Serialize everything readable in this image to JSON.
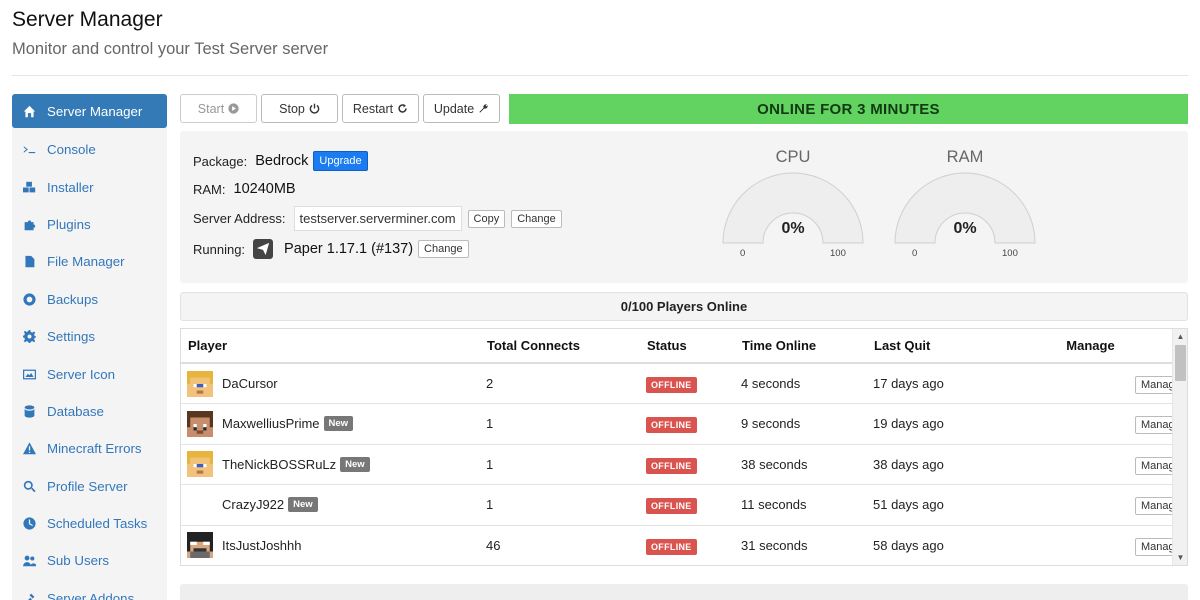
{
  "header": {
    "title": "Server Manager",
    "subtitle": "Monitor and control your Test Server server"
  },
  "sidebar": {
    "items": [
      {
        "label": "Server Manager",
        "icon": "home-icon",
        "active": true
      },
      {
        "label": "Console",
        "icon": "terminal-icon"
      },
      {
        "label": "Installer",
        "icon": "cubes-icon"
      },
      {
        "label": "Plugins",
        "icon": "puzzle-icon"
      },
      {
        "label": "File Manager",
        "icon": "file-icon"
      },
      {
        "label": "Backups",
        "icon": "lifebuoy-icon"
      },
      {
        "label": "Settings",
        "icon": "gear-icon"
      },
      {
        "label": "Server Icon",
        "icon": "image-icon"
      },
      {
        "label": "Database",
        "icon": "database-icon"
      },
      {
        "label": "Minecraft Errors",
        "icon": "warning-icon"
      },
      {
        "label": "Profile Server",
        "icon": "search-icon"
      },
      {
        "label": "Scheduled Tasks",
        "icon": "clock-icon"
      },
      {
        "label": "Sub Users",
        "icon": "users-icon"
      },
      {
        "label": "Server Addons",
        "icon": "addon-icon"
      }
    ]
  },
  "toolbar": {
    "start_label": "Start",
    "stop_label": "Stop",
    "restart_label": "Restart",
    "update_label": "Update",
    "status_text": "ONLINE FOR 3 MINUTES",
    "status_color": "#62d261"
  },
  "info": {
    "package_label": "Package:",
    "package_value": "Bedrock",
    "upgrade_label": "Upgrade",
    "ram_label": "RAM:",
    "ram_value": "10240MB",
    "address_label": "Server Address:",
    "address_value": "testserver.serverminer.com",
    "copy_label": "Copy",
    "change_label": "Change",
    "running_label": "Running:",
    "running_value": "Paper 1.17.1 (#137)",
    "running_change_label": "Change"
  },
  "gauges": {
    "cpu": {
      "title": "CPU",
      "value": "0%",
      "min": "0",
      "max": "100"
    },
    "ram": {
      "title": "RAM",
      "value": "0%",
      "min": "0",
      "max": "100"
    }
  },
  "players": {
    "header": "0/100 Players Online",
    "columns": [
      "Player",
      "Total Connects",
      "Status",
      "Time Online",
      "Last Quit",
      "Manage"
    ],
    "rows": [
      {
        "name": "DaCursor",
        "new": "",
        "connects": "2",
        "status": "OFFLINE",
        "time_online": "4 seconds",
        "last_quit": "17 days ago",
        "manage": "Manage",
        "avatar": "blonde"
      },
      {
        "name": "MaxwelliusPrime",
        "new": "New",
        "connects": "1",
        "status": "OFFLINE",
        "time_online": "9 seconds",
        "last_quit": "19 days ago",
        "manage": "Manage",
        "avatar": "brown"
      },
      {
        "name": "TheNickBOSSRuLz",
        "new": "New",
        "connects": "1",
        "status": "OFFLINE",
        "time_online": "38 seconds",
        "last_quit": "38 days ago",
        "manage": "Manage",
        "avatar": "blonde2"
      },
      {
        "name": "CrazyJ922",
        "new": "New",
        "connects": "1",
        "status": "OFFLINE",
        "time_online": "11 seconds",
        "last_quit": "51 days ago",
        "manage": "Manage",
        "avatar": "none"
      },
      {
        "name": "ItsJustJoshhh",
        "new": "",
        "connects": "46",
        "status": "OFFLINE",
        "time_online": "31 seconds",
        "last_quit": "58 days ago",
        "manage": "Manage",
        "avatar": "dark"
      }
    ]
  }
}
